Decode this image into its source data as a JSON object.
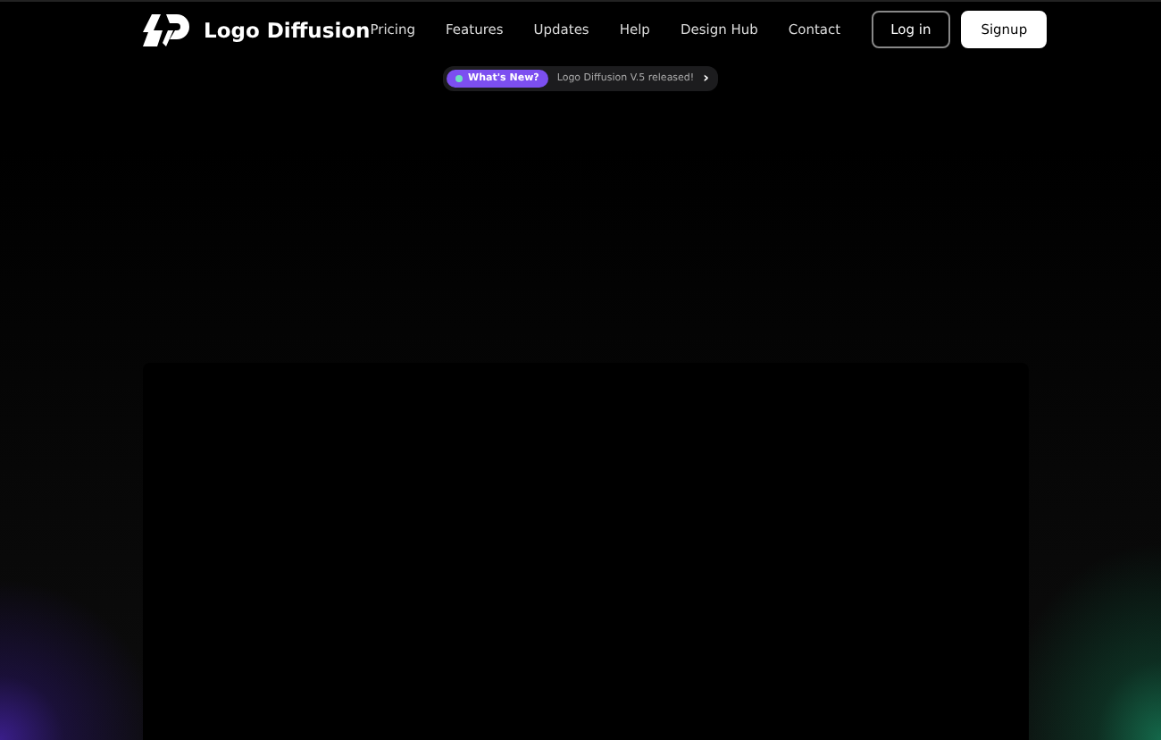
{
  "brand": {
    "name": "Logo Diffusion"
  },
  "nav": [
    "Pricing",
    "Features",
    "Updates",
    "Help",
    "Design Hub",
    "Contact"
  ],
  "actions": [
    {
      "label": "Log in",
      "kind": "outline"
    },
    {
      "label": "Signup",
      "kind": "solid"
    }
  ],
  "announcement": {
    "tag": "What's New?",
    "text": "Logo Diffusion V.5 released!",
    "arrow": "›"
  }
}
